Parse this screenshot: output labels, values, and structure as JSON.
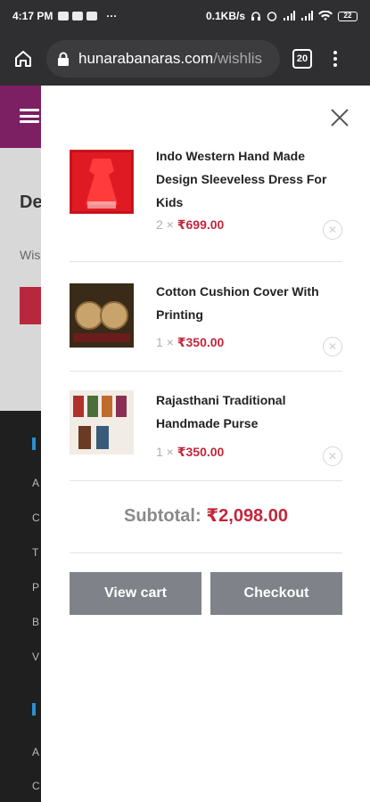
{
  "status_bar": {
    "time": "4:17 PM",
    "speed": "0.1KB/s",
    "battery": "22"
  },
  "browser": {
    "url_domain": "hunarabanaras.com",
    "url_path": "/wishlis",
    "tab_count": "20"
  },
  "background_page": {
    "heading": "De",
    "subtext": "Wis",
    "footer_items": [
      "A",
      "C",
      "T",
      "P",
      "B",
      "V",
      "A",
      "C"
    ]
  },
  "cart": {
    "items": [
      {
        "title": "Indo Western Hand Made Design Sleeveless Dress For Kids",
        "qty": "2 ×",
        "price": "₹699.00",
        "thumb": "red-dress"
      },
      {
        "title": "Cotton Cushion Cover With Printing",
        "qty": "1 ×",
        "price": "₹350.00",
        "thumb": "cushion-covers"
      },
      {
        "title": "Rajasthani Traditional Handmade Purse",
        "qty": "1 ×",
        "price": "₹350.00",
        "thumb": "purses"
      }
    ],
    "subtotal_label": "Subtotal:",
    "subtotal_amount": "₹2,098.00",
    "view_cart_label": "View cart",
    "checkout_label": "Checkout"
  },
  "colors": {
    "accent_price": "#c1273a",
    "header_brand": "#7c1f63",
    "button_gray": "#7f8288"
  }
}
